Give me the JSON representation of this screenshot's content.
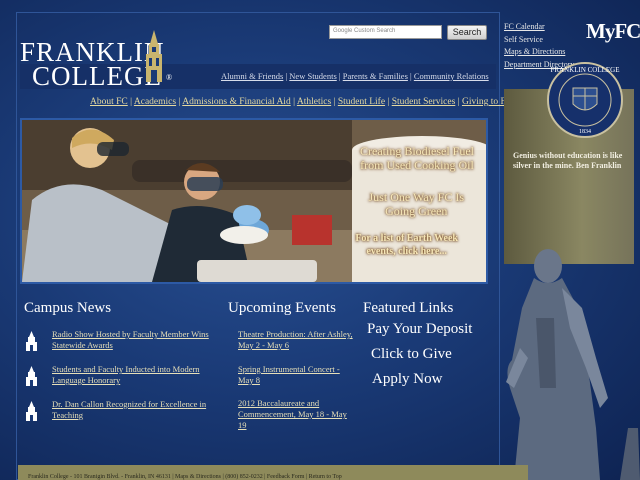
{
  "brand": {
    "line1": "FRANKLIN",
    "line2": "COLLEGE",
    "reg": "®",
    "portal": "MyFC"
  },
  "search": {
    "placeholder": "Google Custom Search",
    "button": "Search"
  },
  "utility_links": [
    "FC Calendar",
    "Self Service",
    "Maps & Directions",
    "Department Directory"
  ],
  "secondary_nav": [
    "Alumni & Friends",
    "New Students",
    "Parents & Families",
    "Community Relations"
  ],
  "main_nav": [
    "About FC",
    "Academics",
    "Admissions & Financial Aid",
    "Athletics",
    "Student Life",
    "Student Services",
    "Giving to FC"
  ],
  "hero": {
    "line1": "Creating Biodiesel Fuel",
    "line2": "from Used Cooking Oil",
    "line3": "Just One Way FC Is",
    "line4": "Going Green",
    "line5": "For a list of Earth Week",
    "line6": "events, click here..."
  },
  "seal": {
    "top": "FRANKLIN COLLEGE",
    "year": "1834"
  },
  "quote": "Genius without education is like silver in the mine. Ben Franklin",
  "campus_news": {
    "title": "Campus News",
    "items": [
      "Radio Show Hosted by Faculty Member Wins Statewide Awards",
      "Students and Faculty Inducted into Modern Language Honorary",
      "Dr. Dan Callon Recognized for Excellence in Teaching"
    ]
  },
  "events": {
    "title": "Upcoming Events",
    "items": [
      "Theatre Production: After Ashley, May 2 - May 6",
      "Spring Instrumental Concert - May 8",
      "2012 Baccalaureate and Commencement, May 18 - May 19"
    ]
  },
  "featured": {
    "title": "Featured Links",
    "items": [
      "Pay Your Deposit",
      "Click to Give",
      "Apply Now"
    ]
  },
  "footer": "Franklin College - 101 Branigin Blvd. - Franklin, IN 46131 | Maps & Directions | (800) 852-0232 | Feedback Form | Return to Top",
  "colors": {
    "bg": "#1a3a76",
    "gold_text": "#e5d9a0",
    "panel": "#8a8762"
  }
}
